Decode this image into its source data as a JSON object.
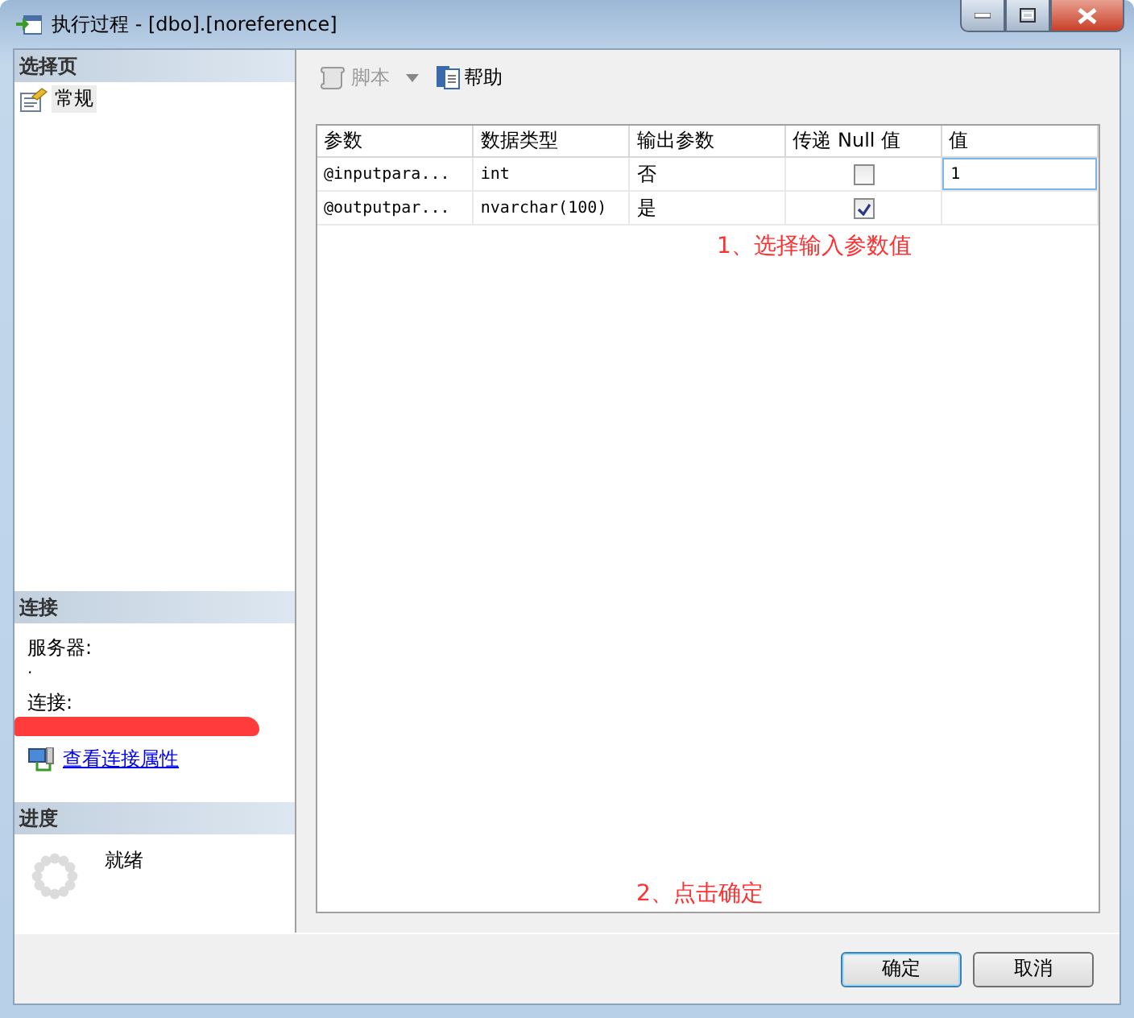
{
  "window": {
    "title": "执行过程 - [dbo].[noreference]"
  },
  "sidebar": {
    "pages_header": "选择页",
    "pages": [
      {
        "label": "常规",
        "selected": true
      }
    ],
    "connection": {
      "header": "连接",
      "server_label": "服务器:",
      "server_value": ".",
      "connection_label": "连接:",
      "link": "查看连接属性"
    },
    "progress": {
      "header": "进度",
      "status": "就绪"
    }
  },
  "toolbar": [
    {
      "label": "脚本",
      "kind": "dropdown",
      "disabled": true
    },
    {
      "label": "帮助",
      "kind": "button",
      "disabled": false
    }
  ],
  "table": {
    "columns": [
      "参数",
      "数据类型",
      "输出参数",
      "传递 Null 值",
      "值"
    ],
    "rows": [
      {
        "parameter": "@inputpara...",
        "data_type": "int",
        "output": "否",
        "pass_null": false,
        "value": "1"
      },
      {
        "parameter": "@outputpar...",
        "data_type": "nvarchar(100)",
        "output": "是",
        "pass_null": true
      }
    ]
  },
  "annotations": [
    "1、选择输入参数值",
    "2、点击确定"
  ],
  "buttons": [
    {
      "label": "确定",
      "default": true
    },
    {
      "label": "取消",
      "default": false
    }
  ]
}
